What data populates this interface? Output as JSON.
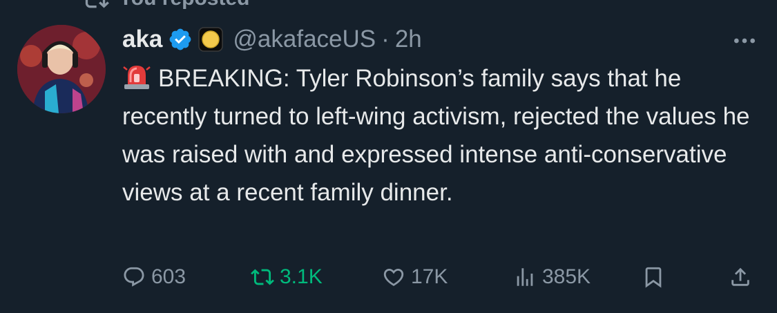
{
  "repost": {
    "label": "You reposted"
  },
  "tweet": {
    "author_name": "aka",
    "handle": "@akafaceUS",
    "separator": "·",
    "time": "2h",
    "text": "BREAKING: Tyler Robinson’s family says that he recently turned to left-wing activism, rejected the values he was raised with and expressed intense anti-conservative views at a recent family dinner.",
    "icons": {
      "verified": "verified-badge-icon",
      "affiliate": "affiliate-badge-icon",
      "siren": "siren-emoji-icon",
      "more": "more-options-icon"
    }
  },
  "actions": {
    "replies": "603",
    "reposts": "3.1K",
    "likes": "17K",
    "views": "385K"
  },
  "colors": {
    "background": "#15202b",
    "text": "#e7e9ea",
    "muted": "#8b98a5",
    "verified": "#1d9bf0",
    "repost_active": "#00ba7c"
  }
}
